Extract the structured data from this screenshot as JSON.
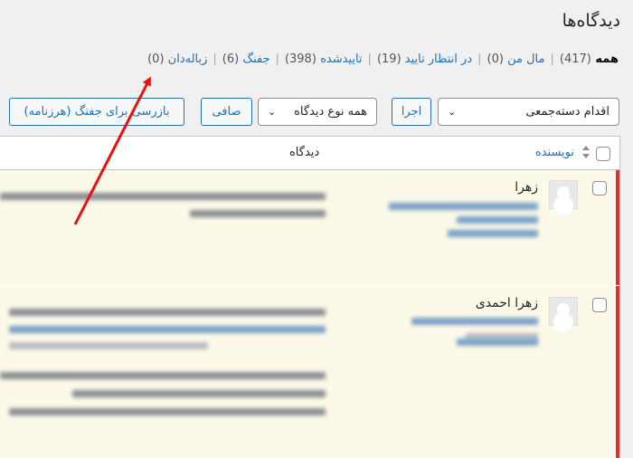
{
  "page": {
    "title": "دیدگاه‌ها"
  },
  "filters": [
    {
      "label": "همه",
      "count": "(417)",
      "current": true
    },
    {
      "label": "مال من",
      "count": "(0)",
      "current": false
    },
    {
      "label": "در انتظار تایید",
      "count": "(19)",
      "current": false
    },
    {
      "label": "تاییدشده",
      "count": "(398)",
      "current": false
    },
    {
      "label": "جفنگ",
      "count": "(6)",
      "current": false
    },
    {
      "label": "زباله‌دان",
      "count": "(0)",
      "current": false
    }
  ],
  "toolbar": {
    "bulk_action": "اقدام دسته‌جمعی",
    "apply": "اجرا",
    "comment_type": "همه نوع دیدگاه",
    "filter": "صافی",
    "check_spam": "بازرسی برای جفنگ (هرزنامه)"
  },
  "table": {
    "col_author": "نویسنده",
    "col_comment": "دیدگاه"
  },
  "comments": [
    {
      "author": "زهرا"
    },
    {
      "author": "زهرا احمدی"
    }
  ],
  "colors": {
    "accent": "#2271b1",
    "pending_border": "#d63638",
    "pending_bg": "#fcf9e8",
    "arrow": "#e3120b"
  }
}
